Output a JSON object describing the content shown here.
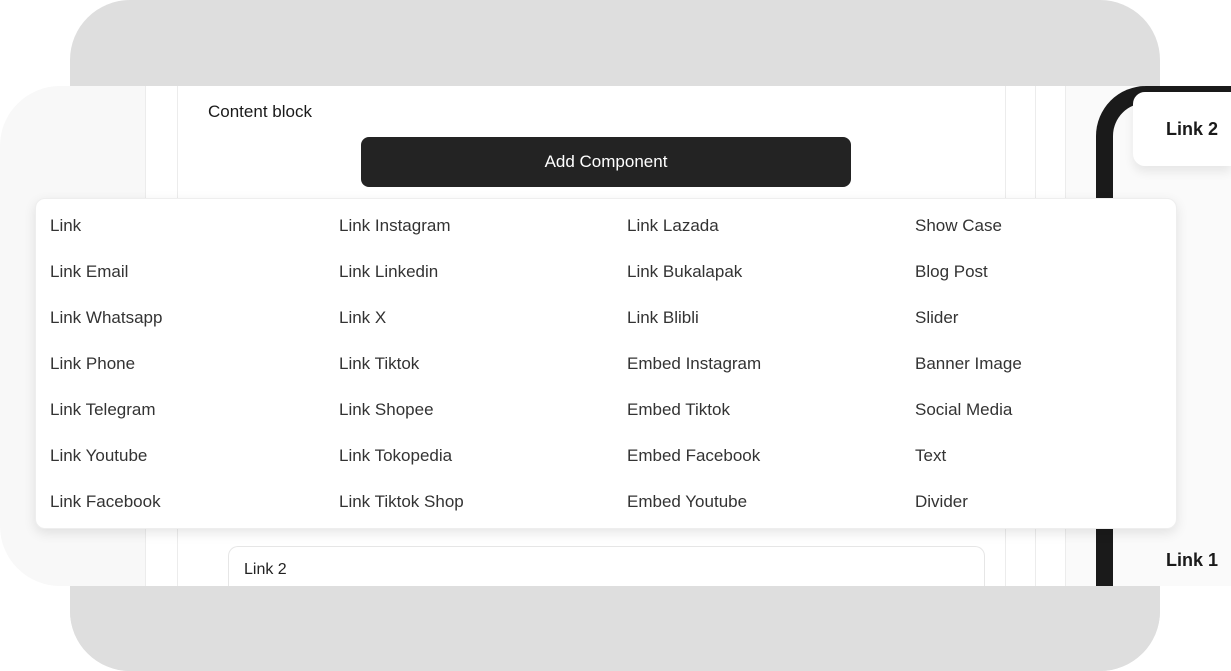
{
  "editor": {
    "section_title": "Content block",
    "add_component_label": "Add Component",
    "link_input_value": "Link 2"
  },
  "preview": {
    "card_label": "Link 2",
    "link1_label": "Link 1"
  },
  "dropdown": {
    "columns": [
      [
        "Link",
        "Link Email",
        "Link Whatsapp",
        "Link Phone",
        "Link Telegram",
        "Link Youtube",
        "Link Facebook"
      ],
      [
        "Link Instagram",
        "Link Linkedin",
        "Link X",
        "Link Tiktok",
        "Link Shopee",
        "Link Tokopedia",
        "Link Tiktok Shop"
      ],
      [
        "Link Lazada",
        "Link Bukalapak",
        "Link Blibli",
        "Embed Instagram",
        "Embed Tiktok",
        "Embed Facebook",
        "Embed Youtube"
      ],
      [
        "Show Case",
        "Blog Post",
        "Slider",
        "Banner Image",
        "Social Media",
        "Text",
        "Divider"
      ]
    ]
  },
  "colors": {
    "button_bg": "#232323",
    "backdrop": "#dedede",
    "phone_frame": "#1a1a1a"
  }
}
